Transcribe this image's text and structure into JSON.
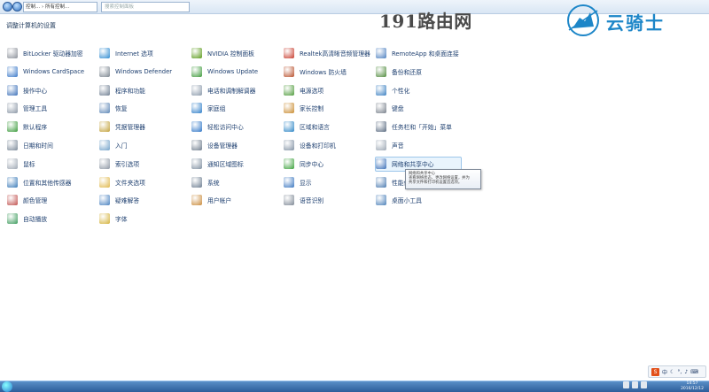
{
  "address": {
    "text": "控制... › 所有控制...",
    "search_placeholder": "搜索控制面板"
  },
  "page_title": "调整计算机的设置",
  "watermark": {
    "site": "191路由网",
    "brand": "云骑士"
  },
  "items": [
    {
      "label": "BitLocker 驱动器加密",
      "icon": "bitlocker-icon",
      "color": "#8a8f98"
    },
    {
      "label": "Internet 选项",
      "icon": "globe-icon",
      "color": "#2e8bd1"
    },
    {
      "label": "NVIDIA 控制面板",
      "icon": "nvidia-icon",
      "color": "#5a9a1a"
    },
    {
      "label": "Realtek高清晰音频管理器",
      "icon": "speaker-icon",
      "color": "#c73b2c"
    },
    {
      "label": "RemoteApp 和桌面连接",
      "icon": "remote-desktop-icon",
      "color": "#4c7fbf"
    },
    {
      "label": "Windows CardSpace",
      "icon": "cardspace-icon",
      "color": "#3a78c8"
    },
    {
      "label": "Windows Defender",
      "icon": "defender-icon",
      "color": "#7b858f"
    },
    {
      "label": "Windows Update",
      "icon": "windows-update-icon",
      "color": "#3d9a3a"
    },
    {
      "label": "Windows 防火墙",
      "icon": "firewall-icon",
      "color": "#b8502c"
    },
    {
      "label": "备份和还原",
      "icon": "backup-icon",
      "color": "#4f8a3c"
    },
    {
      "label": "操作中心",
      "icon": "flag-icon",
      "color": "#3b6fb8"
    },
    {
      "label": "程序和功能",
      "icon": "programs-icon",
      "color": "#6f7f92"
    },
    {
      "label": "电话和调制解调器",
      "icon": "phone-icon",
      "color": "#8a99aa"
    },
    {
      "label": "电源选项",
      "icon": "power-icon",
      "color": "#4e9a3a"
    },
    {
      "label": "个性化",
      "icon": "personalize-icon",
      "color": "#3a7fc1"
    },
    {
      "label": "管理工具",
      "icon": "admin-tools-icon",
      "color": "#8a96a5"
    },
    {
      "label": "恢复",
      "icon": "recovery-icon",
      "color": "#5a84b5"
    },
    {
      "label": "家庭组",
      "icon": "homegroup-icon",
      "color": "#2e7ec9"
    },
    {
      "label": "家长控制",
      "icon": "parental-icon",
      "color": "#c98a2e"
    },
    {
      "label": "键盘",
      "icon": "keyboard-icon",
      "color": "#777f8a"
    },
    {
      "label": "默认程序",
      "icon": "default-programs-icon",
      "color": "#3a9a3a"
    },
    {
      "label": "凭据管理器",
      "icon": "credential-icon",
      "color": "#c2a13a"
    },
    {
      "label": "轻松访问中心",
      "icon": "ease-access-icon",
      "color": "#2f76c7"
    },
    {
      "label": "区域和语言",
      "icon": "region-icon",
      "color": "#2e86c6"
    },
    {
      "label": "任务栏和「开始」菜单",
      "icon": "taskbar-icon",
      "color": "#596a80"
    },
    {
      "label": "日期和时间",
      "icon": "clock-icon",
      "color": "#7a8898"
    },
    {
      "label": "入门",
      "icon": "getting-started-icon",
      "color": "#6fa0c8"
    },
    {
      "label": "设备管理器",
      "icon": "device-manager-icon",
      "color": "#6e7c8c"
    },
    {
      "label": "设备和打印机",
      "icon": "printer-icon",
      "color": "#8090a2"
    },
    {
      "label": "声音",
      "icon": "sound-icon",
      "color": "#9aa5b2"
    },
    {
      "label": "鼠标",
      "icon": "mouse-icon",
      "color": "#9ea7b3"
    },
    {
      "label": "索引选项",
      "icon": "index-icon",
      "color": "#8c96a3"
    },
    {
      "label": "通知区域图标",
      "icon": "notification-icon",
      "color": "#7f8fa0"
    },
    {
      "label": "同步中心",
      "icon": "sync-icon",
      "color": "#3aa03a"
    },
    {
      "label": "网络和共享中心",
      "icon": "network-icon",
      "color": "#3a6fb8"
    },
    {
      "label": "位置和其他传感器",
      "icon": "sensor-icon",
      "color": "#3a7ab8"
    },
    {
      "label": "文件夹选项",
      "icon": "folder-icon",
      "color": "#e0b84a"
    },
    {
      "label": "系统",
      "icon": "system-icon",
      "color": "#6c7d90"
    },
    {
      "label": "显示",
      "icon": "display-icon",
      "color": "#3a76c0"
    },
    {
      "label": "性能信息和工具",
      "icon": "performance-icon",
      "color": "#4a7ab0"
    },
    {
      "label": "颜色管理",
      "icon": "color-icon",
      "color": "#c0504d"
    },
    {
      "label": "疑难解答",
      "icon": "troubleshoot-icon",
      "color": "#4a82c0"
    },
    {
      "label": "用户帐户",
      "icon": "user-accounts-icon",
      "color": "#c98a3a"
    },
    {
      "label": "语音识别",
      "icon": "microphone-icon",
      "color": "#7d8794"
    },
    {
      "label": "桌面小工具",
      "icon": "gadgets-icon",
      "color": "#4a7fb8"
    },
    {
      "label": "自动播放",
      "icon": "autoplay-icon",
      "color": "#3a9a5a"
    },
    {
      "label": "字体",
      "icon": "fonts-icon",
      "color": "#d4b23a"
    }
  ],
  "tooltip": {
    "title": "网络和共享中心",
    "line1": "查看网络状态、更改网络设置，并为",
    "line2": "共享文件和打印机设置首选项。"
  },
  "taskbar": {
    "time": "14:57",
    "date": "2016/12/12"
  },
  "tray": {
    "logo": "S",
    "text": "中"
  }
}
